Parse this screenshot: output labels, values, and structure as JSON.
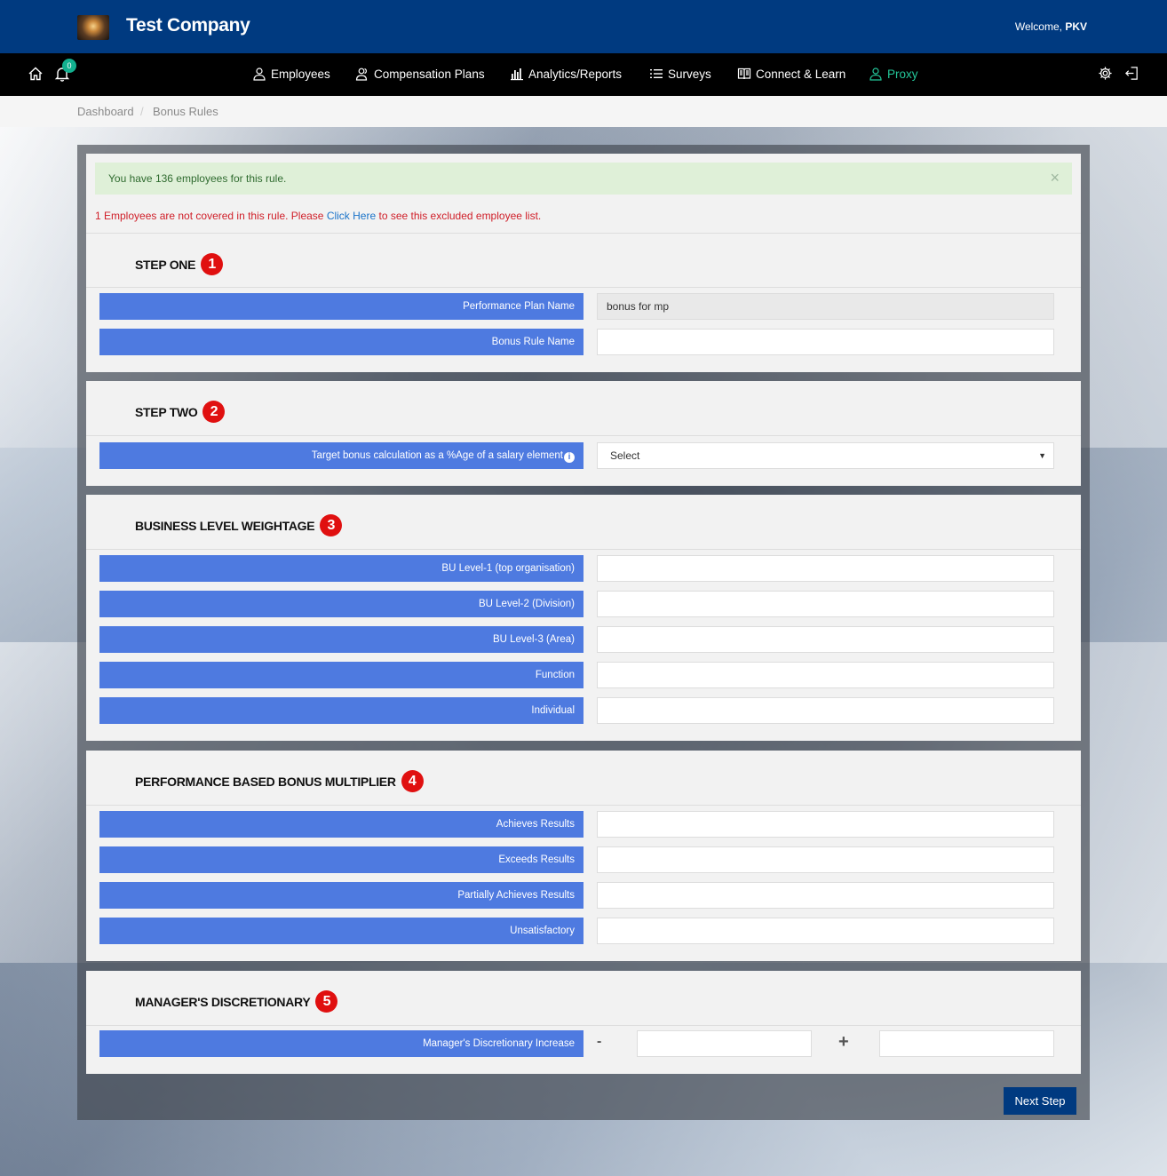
{
  "header": {
    "company": "Test Company",
    "welcome_prefix": "Welcome,",
    "welcome_user": "PKV"
  },
  "nav": {
    "notification_count": "0",
    "items": [
      {
        "label": "Employees",
        "icon": "person-icon"
      },
      {
        "label": "Compensation Plans",
        "icon": "people-icon"
      },
      {
        "label": "Analytics/Reports",
        "icon": "bar-chart-icon"
      },
      {
        "label": "Surveys",
        "icon": "list-icon"
      },
      {
        "label": "Connect & Learn",
        "icon": "book-icon"
      },
      {
        "label": "Proxy",
        "icon": "person-icon"
      }
    ],
    "colors": {
      "proxy": "#24c79a",
      "header_bg": "#003a80"
    }
  },
  "breadcrumb": {
    "dashboard": "Dashboard",
    "separator": "/",
    "current": "Bonus Rules"
  },
  "alert": {
    "message": "You have 136 employees for this rule.",
    "close": "×"
  },
  "excluded": {
    "before": "1 Employees are not covered in this rule. Please ",
    "link": "Click Here",
    "after": " to see this excluded employee list."
  },
  "step1": {
    "title": "STEP ONE",
    "num": "1",
    "plan_label": "Performance Plan Name",
    "plan_value": "bonus for mp",
    "rule_label": "Bonus Rule Name",
    "rule_value": ""
  },
  "step2": {
    "title": "STEP TWO",
    "num": "2",
    "target_label": "Target bonus calculation as a %Age of a salary element",
    "info": "i",
    "target_value": "Select",
    "arrow": "▼"
  },
  "step3": {
    "title": "BUSINESS LEVEL WEIGHTAGE",
    "num": "3",
    "rows": [
      "BU Level-1 (top organisation)",
      "BU Level-2 (Division)",
      "BU Level-3 (Area)",
      "Function",
      "Individual"
    ]
  },
  "step4": {
    "title": "PERFORMANCE BASED BONUS MULTIPLIER",
    "num": "4",
    "rows": [
      "Achieves Results",
      "Exceeds Results",
      "Partially Achieves Results",
      "Unsatisfactory"
    ]
  },
  "step5": {
    "title": "MANAGER'S DISCRETIONARY",
    "num": "5",
    "label": "Manager's Discretionary Increase",
    "minus": "-",
    "plus": "+"
  },
  "actions": {
    "next": "Next Step"
  }
}
